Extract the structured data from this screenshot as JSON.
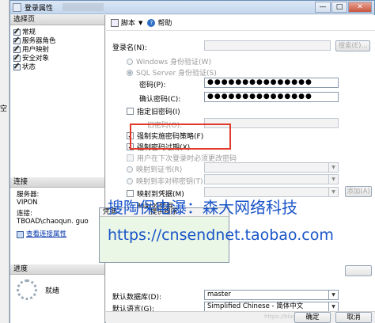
{
  "outside": {
    "label": "空"
  },
  "window": {
    "title": "登录属性",
    "close_symbol": "✕",
    "max_symbol": "□",
    "min_symbol": "—"
  },
  "left": {
    "select_page_header": "选择页",
    "pages": [
      "常规",
      "服务器角色",
      "用户映射",
      "安全对象",
      "状态"
    ],
    "connection_header": "连接",
    "server_label": "服务器:",
    "server_value": "VIPON",
    "conn_label": "连接:",
    "conn_value": "TBOAD\\chaoqun. guo",
    "view_props_link": "查看连接属性",
    "progress_header": "进度",
    "progress_status": "就绪"
  },
  "toolbar": {
    "script_label": "脚本",
    "dropdown_symbol": "▼",
    "help_label": "帮助"
  },
  "form": {
    "login_name_label": "登录名(N):",
    "search_button": "搜索(E)...",
    "windows_auth": "Windows 身份验证(W)",
    "sql_auth": "SQL Server 身份验证(S)",
    "password_label": "密码(P):",
    "password_value": "●●●●●●●●●●●●●●●",
    "confirm_label": "确认密码(C):",
    "confirm_value": "●●●●●●●●●●●●●●●",
    "old_pw_checkbox": "指定旧密码(I)",
    "old_pw_label": "旧密码(O):",
    "enforce_policy": "强制实施密码策略(F)",
    "enforce_expiry": "强制密码过期(X)",
    "must_change": "用户在下次登录时必须更改密码",
    "map_cert": "映射到证书(R)",
    "map_asym": "映射到非对称密钥(T)",
    "map_cred": "映射到凭据(M)",
    "add_button": "添加(A)",
    "mapped_creds_label": "映射的凭据",
    "grid_col_credential": "凭据",
    "grid_col_provider": "提供程序",
    "default_db_label": "默认数据库(D):",
    "default_db_value": "master",
    "default_lang_label": "默认语言(G):",
    "default_lang_value": "Simplified Chinese - 简体中文"
  },
  "overlay": {
    "watermark_line1": "搜陶保电瀑：森大网络科技",
    "watermark_line2": "https://cnsendnet.taobao.com"
  },
  "footer": {
    "ok_button": "确定",
    "cancel_button": "取消",
    "blog_watermark": "https://blog.csdn.net/..."
  },
  "colors": {
    "accent_red": "#e23a2a",
    "watermark_blue": "#1a55c8"
  }
}
